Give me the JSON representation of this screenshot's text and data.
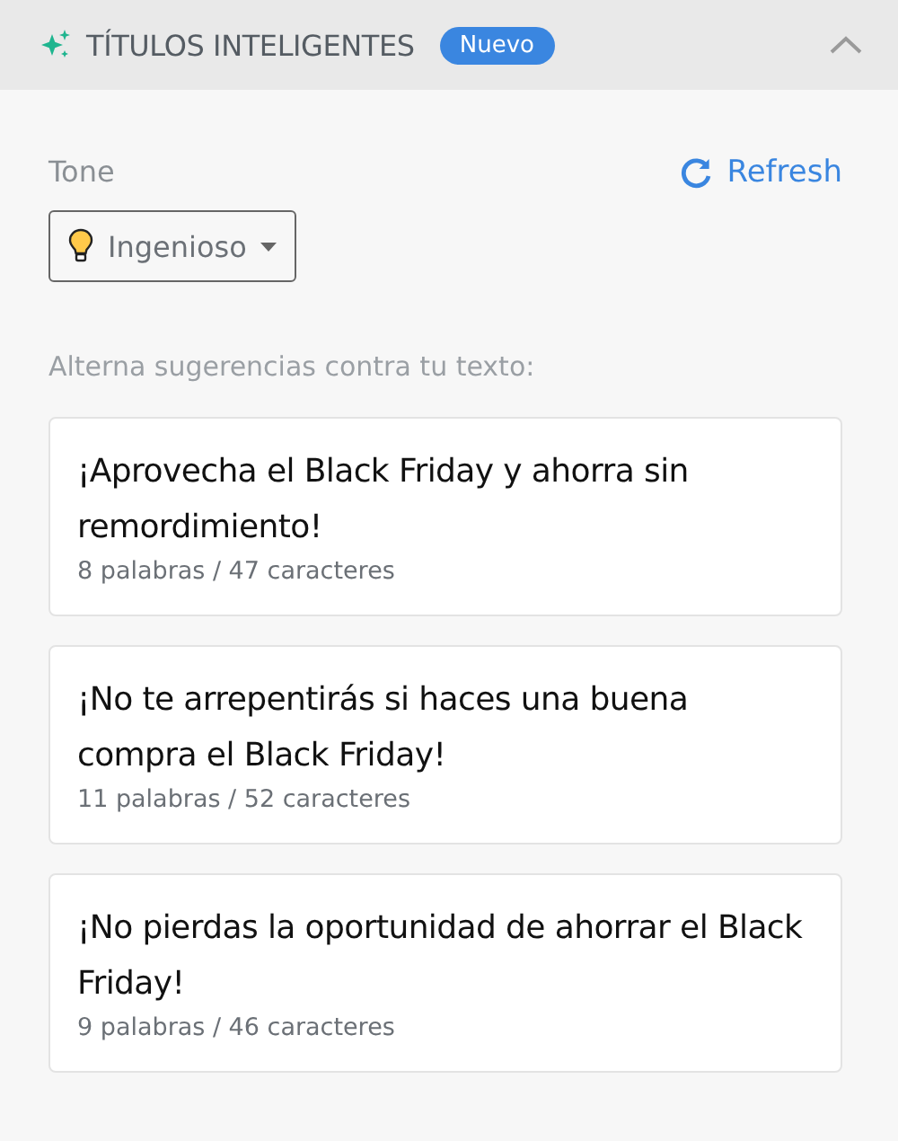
{
  "panel": {
    "title": "TÍTULOS INTELIGENTES",
    "badge": "Nuevo",
    "expanded": true
  },
  "tone": {
    "label": "Tone",
    "value": "Ingenioso"
  },
  "refresh": "Refresh",
  "hint": "Alterna sugerencias contra tu texto:",
  "suggestions": [
    {
      "text": "¡Aprovecha el Black Friday y ahorra sin remordimiento!",
      "meta": "8 palabras / 47 caracteres"
    },
    {
      "text": "¡No te arrepentirás si haces una buena compra el Black Friday!",
      "meta": "11 palabras / 52 caracteres"
    },
    {
      "text": "¡No pierdas la oportunidad de ahorrar el Black Friday!",
      "meta": "9 palabras / 46 caracteres"
    }
  ]
}
